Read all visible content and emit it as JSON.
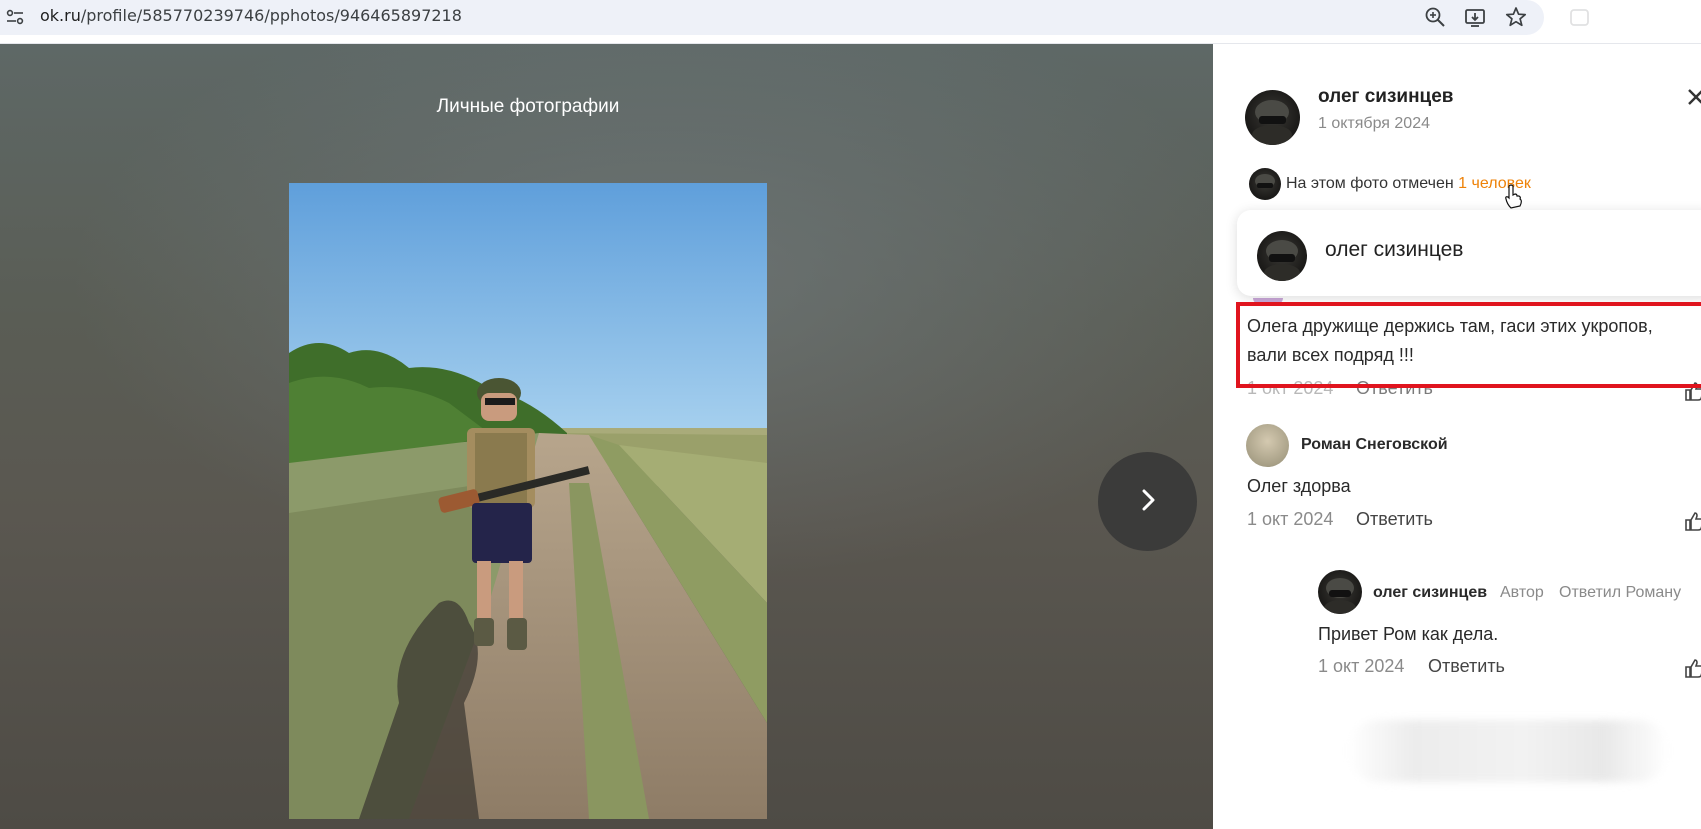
{
  "browser": {
    "url_domain": "ok.ru",
    "url_path": "/profile/585770239746/pphotos/946465897218",
    "icons": [
      "site-settings-icon",
      "zoom-icon",
      "install-app-icon",
      "bookmark-star-icon",
      "extension-icon"
    ]
  },
  "viewer": {
    "album_title": "Личные фотографии",
    "next_icon": "chevron-right-icon"
  },
  "panel": {
    "author": {
      "name": "олег сизинцев",
      "date": "1 октября 2024"
    },
    "tags": {
      "prefix": "На этом фото отмечен ",
      "link": "1 человек"
    },
    "tag_popup": {
      "name": "олег сизинцев"
    },
    "comments": [
      {
        "text_line1": "Олега дружище держись там, гаси этих укропов,",
        "text_line2": "вали всех подряд !!!",
        "date": "1 окт 2024",
        "reply": "Ответить",
        "highlighted": true
      },
      {
        "name": "Роман Снеговской",
        "text": "Олег здорва",
        "date": "1 окт 2024",
        "reply": "Ответить"
      },
      {
        "name": "олег сизинцев",
        "badge": "Автор",
        "replied_to": "Ответил Роману",
        "text": "Привет Ром как дела.",
        "date": "1 окт 2024",
        "reply": "Ответить"
      }
    ]
  },
  "colors": {
    "accent_link": "#ee8208",
    "highlight": "#e0141e",
    "muted": "#8a8a8a"
  }
}
